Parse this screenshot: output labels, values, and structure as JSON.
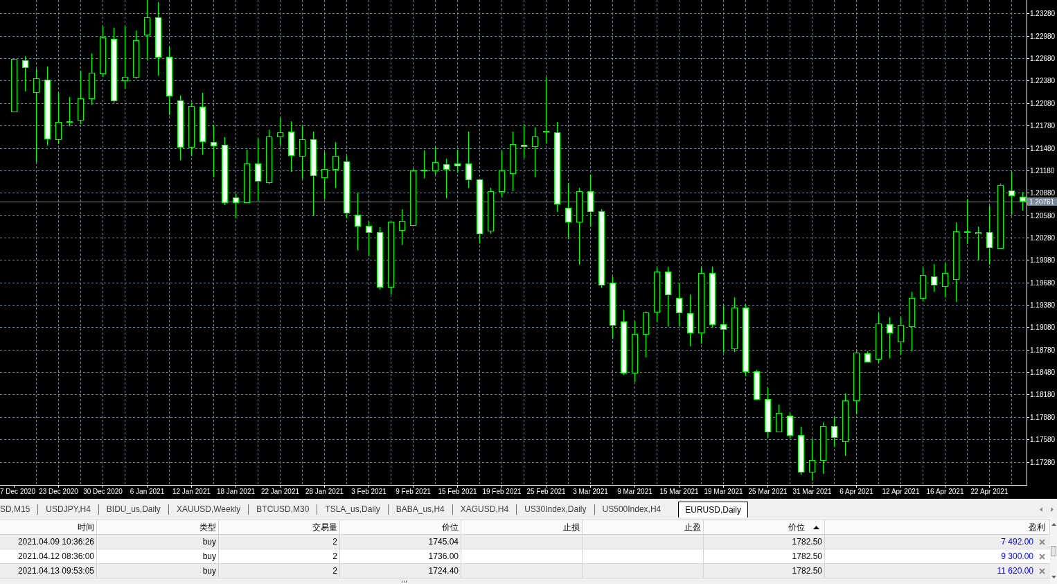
{
  "chart": {
    "chart_data": {
      "type": "candlestick",
      "color": "#00ff00",
      "grid": true,
      "ylim": [
        1.1697,
        1.2346
      ],
      "yticks": [
        {
          "value": 1.2328,
          "label": "1.23280"
        },
        {
          "value": 1.2298,
          "label": "1.22980"
        },
        {
          "value": 1.2268,
          "label": "1.22680"
        },
        {
          "value": 1.2238,
          "label": "1.22380"
        },
        {
          "value": 1.2208,
          "label": "1.22080"
        },
        {
          "value": 1.2178,
          "label": "1.21780"
        },
        {
          "value": 1.2148,
          "label": "1.21480"
        },
        {
          "value": 1.2118,
          "label": "1.21180"
        },
        {
          "value": 1.2088,
          "label": "1.20880"
        },
        {
          "value": 1.2058,
          "label": "1.20580"
        },
        {
          "value": 1.2028,
          "label": "1.20280"
        },
        {
          "value": 1.1998,
          "label": "1.19980"
        },
        {
          "value": 1.1968,
          "label": "1.19680"
        },
        {
          "value": 1.1938,
          "label": "1.19380"
        },
        {
          "value": 1.1908,
          "label": "1.19080"
        },
        {
          "value": 1.1878,
          "label": "1.18780"
        },
        {
          "value": 1.1848,
          "label": "1.18480"
        },
        {
          "value": 1.1818,
          "label": "1.18180"
        },
        {
          "value": 1.1788,
          "label": "1.17880"
        },
        {
          "value": 1.1758,
          "label": "1.17580"
        },
        {
          "value": 1.1728,
          "label": "1.17280"
        }
      ],
      "ref_lines": [
        {
          "axis": "y",
          "value": 1.20761,
          "label": "1.20761",
          "color": "#778899"
        }
      ],
      "categories": [
        "7 Dec 2020",
        null,
        null,
        null,
        "23 Dec 2020",
        null,
        null,
        null,
        "30 Dec 2020",
        null,
        null,
        null,
        "6 Jan 2021",
        null,
        null,
        null,
        "12 Jan 2021",
        null,
        null,
        null,
        "18 Jan 2021",
        null,
        null,
        null,
        "22 Jan 2021",
        null,
        null,
        null,
        "28 Jan 2021",
        null,
        null,
        null,
        "3 Feb 2021",
        null,
        null,
        null,
        "9 Feb 2021",
        null,
        null,
        null,
        "15 Feb 2021",
        null,
        null,
        null,
        "19 Feb 2021",
        null,
        null,
        null,
        "25 Feb 2021",
        null,
        null,
        null,
        "3 Mar 2021",
        null,
        null,
        null,
        "9 Mar 2021",
        null,
        null,
        null,
        "15 Mar 2021",
        null,
        null,
        null,
        "19 Mar 2021",
        null,
        null,
        null,
        "25 Mar 2021",
        null,
        null,
        null,
        "31 Mar 2021",
        null,
        null,
        null,
        "6 Apr 2021",
        null,
        null,
        null,
        "12 Apr 2021",
        null,
        null,
        null,
        "16 Apr 2021",
        null,
        null,
        null,
        "22 Apr 2021",
        null,
        null,
        null
      ],
      "ohlc": [
        [
          1.2197,
          1.2267,
          1.2197,
          1.2267
        ],
        [
          1.2265,
          1.2271,
          1.2224,
          1.2256
        ],
        [
          1.2223,
          1.2254,
          1.2129,
          1.2241
        ],
        [
          1.2239,
          1.2257,
          1.2151,
          1.2161
        ],
        [
          1.216,
          1.2222,
          1.2153,
          1.2183
        ],
        [
          1.2183,
          1.2216,
          1.2177,
          1.2184
        ],
        [
          1.2186,
          1.2251,
          1.218,
          1.2214
        ],
        [
          1.2214,
          1.2275,
          1.2206,
          1.2249
        ],
        [
          1.2248,
          1.2311,
          1.2243,
          1.2296
        ],
        [
          1.2294,
          1.2309,
          1.2209,
          1.2212
        ],
        [
          1.2238,
          1.2311,
          1.2227,
          1.2243
        ],
        [
          1.2243,
          1.2305,
          1.2241,
          1.2292
        ],
        [
          1.23,
          1.2349,
          1.2265,
          1.2323
        ],
        [
          1.2323,
          1.2343,
          1.2245,
          1.227
        ],
        [
          1.227,
          1.2284,
          1.2192,
          1.2218
        ],
        [
          1.2212,
          1.2218,
          1.2132,
          1.2149
        ],
        [
          1.2149,
          1.2209,
          1.2137,
          1.2204
        ],
        [
          1.2203,
          1.2222,
          1.2139,
          1.2157
        ],
        [
          1.2156,
          1.2179,
          1.2109,
          1.2151
        ],
        [
          1.2152,
          1.2162,
          1.2072,
          1.2075
        ],
        [
          1.2082,
          1.2087,
          1.2054,
          1.2075
        ],
        [
          1.2075,
          1.2146,
          1.2074,
          1.2127
        ],
        [
          1.2127,
          1.2161,
          1.2077,
          1.2104
        ],
        [
          1.2102,
          1.2173,
          1.21,
          1.2163
        ],
        [
          1.2163,
          1.2189,
          1.2151,
          1.2169
        ],
        [
          1.217,
          1.2184,
          1.2116,
          1.2138
        ],
        [
          1.2137,
          1.2177,
          1.2107,
          1.216
        ],
        [
          1.216,
          1.217,
          1.2058,
          1.2111
        ],
        [
          1.2109,
          1.2143,
          1.208,
          1.212
        ],
        [
          1.212,
          1.2156,
          1.2095,
          1.2137
        ],
        [
          1.213,
          1.2137,
          1.2054,
          1.2061
        ],
        [
          1.2059,
          1.2088,
          1.2011,
          1.2044
        ],
        [
          1.2044,
          1.205,
          1.2003,
          1.2035
        ],
        [
          1.2035,
          1.2042,
          1.1958,
          1.1962
        ],
        [
          1.1962,
          1.205,
          1.1952,
          1.2049
        ],
        [
          1.2038,
          1.2066,
          1.2019,
          1.205
        ],
        [
          1.2045,
          1.2121,
          1.2045,
          1.2118
        ],
        [
          1.2118,
          1.2145,
          1.2108,
          1.2119
        ],
        [
          1.2118,
          1.2149,
          1.2112,
          1.2129
        ],
        [
          1.2126,
          1.2134,
          1.2081,
          1.212
        ],
        [
          1.2127,
          1.2146,
          1.2115,
          1.2124
        ],
        [
          1.2127,
          1.217,
          1.2095,
          1.2106
        ],
        [
          1.2106,
          1.2107,
          1.2021,
          1.2034
        ],
        [
          1.2037,
          1.2095,
          1.2034,
          1.209
        ],
        [
          1.209,
          1.2145,
          1.2082,
          1.2118
        ],
        [
          1.2114,
          1.217,
          1.209,
          1.2153
        ],
        [
          1.2152,
          1.218,
          1.2135,
          1.215
        ],
        [
          1.215,
          1.2175,
          1.2109,
          1.2163
        ],
        [
          1.217,
          1.2243,
          1.2154,
          1.2171
        ],
        [
          1.2169,
          1.2183,
          1.2062,
          1.2073
        ],
        [
          1.2068,
          1.2101,
          1.2026,
          1.2049
        ],
        [
          1.2049,
          1.2095,
          1.1992,
          1.209
        ],
        [
          1.209,
          1.2112,
          1.2043,
          1.2063
        ],
        [
          1.2063,
          1.2066,
          1.1961,
          1.1965
        ],
        [
          1.1968,
          1.1976,
          1.1893,
          1.1911
        ],
        [
          1.1916,
          1.1932,
          1.1844,
          1.1847
        ],
        [
          1.1847,
          1.1916,
          1.1835,
          1.1899
        ],
        [
          1.1899,
          1.1929,
          1.1868,
          1.1928
        ],
        [
          1.1929,
          1.1989,
          1.1915,
          1.1983
        ],
        [
          1.1983,
          1.1989,
          1.1909,
          1.1952
        ],
        [
          1.1947,
          1.1968,
          1.1909,
          1.1928
        ],
        [
          1.1927,
          1.1952,
          1.1882,
          1.1901
        ],
        [
          1.1901,
          1.1988,
          1.1886,
          1.1981
        ],
        [
          1.1981,
          1.1989,
          1.1907,
          1.1912
        ],
        [
          1.1912,
          1.1937,
          1.1874,
          1.1906
        ],
        [
          1.188,
          1.1948,
          1.1875,
          1.1934
        ],
        [
          1.1934,
          1.1939,
          1.1843,
          1.1849
        ],
        [
          1.1849,
          1.1851,
          1.181,
          1.1812
        ],
        [
          1.1812,
          1.1828,
          1.1761,
          1.1768
        ],
        [
          1.1768,
          1.1805,
          1.1767,
          1.1793
        ],
        [
          1.179,
          1.1793,
          1.1759,
          1.1764
        ],
        [
          1.1764,
          1.1775,
          1.1711,
          1.1715
        ],
        [
          1.1715,
          1.1759,
          1.1703,
          1.173
        ],
        [
          1.173,
          1.178,
          1.1712,
          1.1776
        ],
        [
          1.1776,
          1.1788,
          1.1748,
          1.1761
        ],
        [
          1.1755,
          1.1819,
          1.1736,
          1.181
        ],
        [
          1.181,
          1.1876,
          1.1792,
          1.1874
        ],
        [
          1.1873,
          1.1876,
          1.1861,
          1.1862
        ],
        [
          1.1866,
          1.1927,
          1.186,
          1.1913
        ],
        [
          1.1912,
          1.1921,
          1.1867,
          1.1901
        ],
        [
          1.1889,
          1.1922,
          1.1871,
          1.1911
        ],
        [
          1.1909,
          1.1956,
          1.1876,
          1.1947
        ],
        [
          1.1947,
          1.1989,
          1.1943,
          1.1978
        ],
        [
          1.1976,
          1.1993,
          1.1956,
          1.1965
        ],
        [
          1.1963,
          1.1995,
          1.1948,
          1.1981
        ],
        [
          1.1972,
          1.2048,
          1.1942,
          1.2036
        ],
        [
          1.2035,
          1.208,
          1.202,
          1.2036
        ],
        [
          1.2034,
          1.2043,
          1.1998,
          1.2035
        ],
        [
          1.2035,
          1.2071,
          1.1992,
          1.2015
        ],
        [
          1.2014,
          1.21,
          1.2013,
          1.2098
        ],
        [
          1.2091,
          1.2117,
          1.2059,
          1.2085
        ],
        [
          1.2083,
          1.2089,
          1.2064,
          1.2077
        ]
      ]
    }
  },
  "tabs": [
    {
      "label": "SD,M15",
      "selected": false
    },
    {
      "label": "USDJPY,H4",
      "selected": false
    },
    {
      "label": "BIDU_us,Daily",
      "selected": false
    },
    {
      "label": "XAUUSD,Weekly",
      "selected": false
    },
    {
      "label": "BTCUSD,M30",
      "selected": false
    },
    {
      "label": "TSLA_us,Daily",
      "selected": false
    },
    {
      "label": "BABA_us,H4",
      "selected": false
    },
    {
      "label": "XAGUSD,H4",
      "selected": false
    },
    {
      "label": "US30Index,Daily",
      "selected": false
    },
    {
      "label": "US500Index,H4",
      "selected": false
    },
    {
      "label": "EURUSD,Daily",
      "selected": true
    }
  ],
  "table": {
    "columns": [
      {
        "label": "时间",
        "sorted": false
      },
      {
        "label": "类型",
        "sorted": false
      },
      {
        "label": "交易量",
        "sorted": false
      },
      {
        "label": "价位",
        "sorted": false
      },
      {
        "label": "止损",
        "sorted": false
      },
      {
        "label": "止盈",
        "sorted": false
      },
      {
        "label": "价位",
        "sorted": true
      },
      {
        "label": "盈利",
        "sorted": false
      }
    ],
    "rows": [
      {
        "time": "2021.04.09 10:36:26",
        "type": "buy",
        "volume": "2",
        "open_price": "1745.04",
        "current_price": "1782.50",
        "profit": "7 492.00"
      },
      {
        "time": "2021.04.12 08:36:00",
        "type": "buy",
        "volume": "2",
        "open_price": "1736.00",
        "current_price": "1782.50",
        "profit": "9 300.00"
      },
      {
        "time": "2021.04.13 09:53:05",
        "type": "buy",
        "volume": "2",
        "open_price": "1724.40",
        "current_price": "1782.50",
        "profit": "11 620.00"
      }
    ]
  }
}
